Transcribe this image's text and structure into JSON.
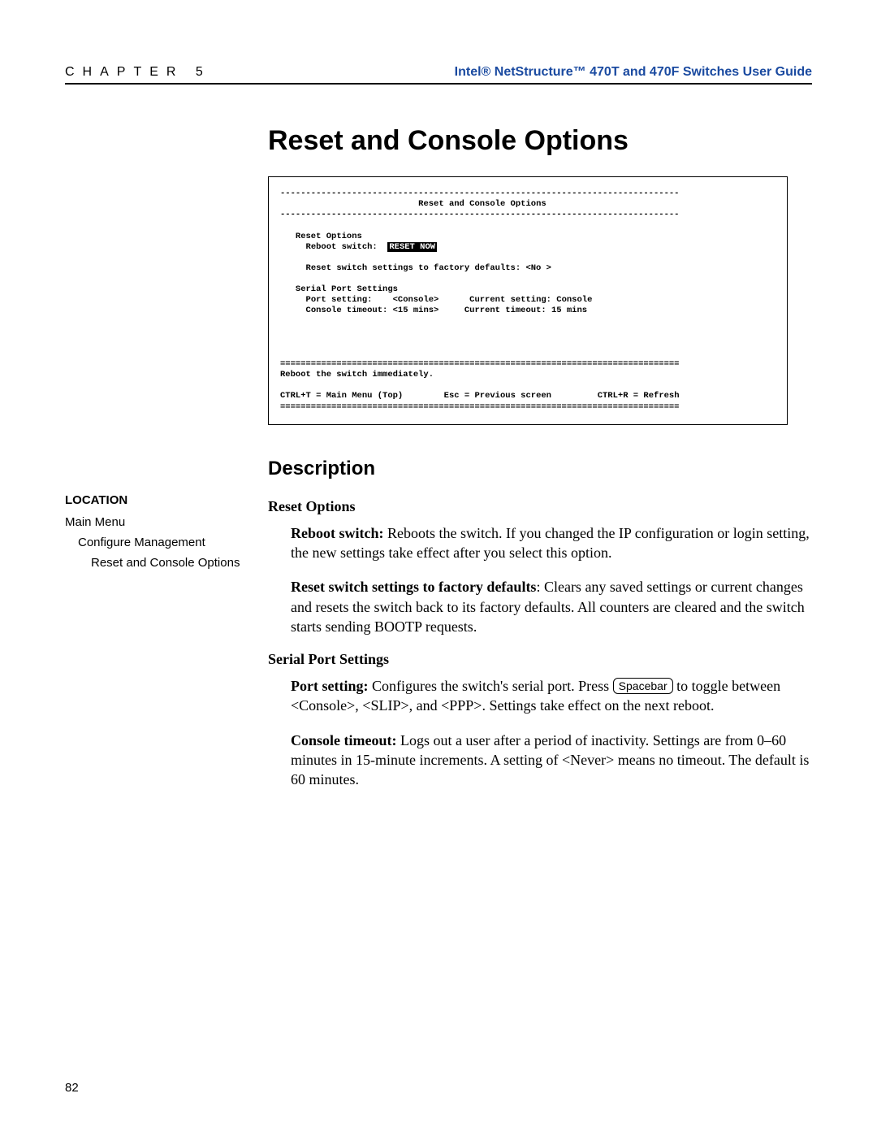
{
  "header": {
    "chapter": "CHAPTER 5",
    "guide": "Intel® NetStructure™ 470T and 470F Switches User Guide"
  },
  "title": "Reset and Console Options",
  "terminal": {
    "head": "Reset and Console Options",
    "reset_options": "Reset Options",
    "reboot_label": "Reboot switch:",
    "reboot_value": "RESET NOW",
    "reset_factory": "Reset switch settings to factory defaults: <No >",
    "serial_head": "Serial Port Settings",
    "port_setting": "Port setting:    <Console>",
    "port_current": "Current setting: Console",
    "timeout_setting": "Console timeout: <15 mins>",
    "timeout_current": "Current timeout: 15 mins",
    "help": "Reboot the switch immediately.",
    "nav1": "CTRL+T = Main Menu (Top)",
    "nav2": "Esc = Previous screen",
    "nav3": "CTRL+R = Refresh"
  },
  "location": {
    "heading": "LOCATION",
    "l1": "Main Menu",
    "l2": "Configure Management",
    "l3": "Reset and Console Options"
  },
  "description": {
    "heading": "Description",
    "reset_options_head": "Reset Options",
    "reboot_b": "Reboot switch:",
    "reboot_t": " Reboots the switch. If you changed the IP configuration or login setting, the new settings take effect after you select this option.",
    "factory_b": "Reset switch settings to factory defaults",
    "factory_t": ": Clears any saved settings or current changes and resets the switch back to its factory defaults. All counters are cleared and the switch starts sending BOOTP requests.",
    "serial_head": "Serial Port Settings",
    "port_b": "Port setting:",
    "port_t1": " Configures the switch's serial port. Press ",
    "port_key": "Spacebar",
    "port_t2": " to toggle between <Console>, <SLIP>, and <PPP>. Settings take effect on the next reboot.",
    "timeout_b": "Console timeout:",
    "timeout_t": " Logs out a user after a period of inactivity. Settings are from 0–60 minutes in 15-minute increments. A setting of <Never> means no timeout. The default is 60 minutes."
  },
  "page_number": "82"
}
